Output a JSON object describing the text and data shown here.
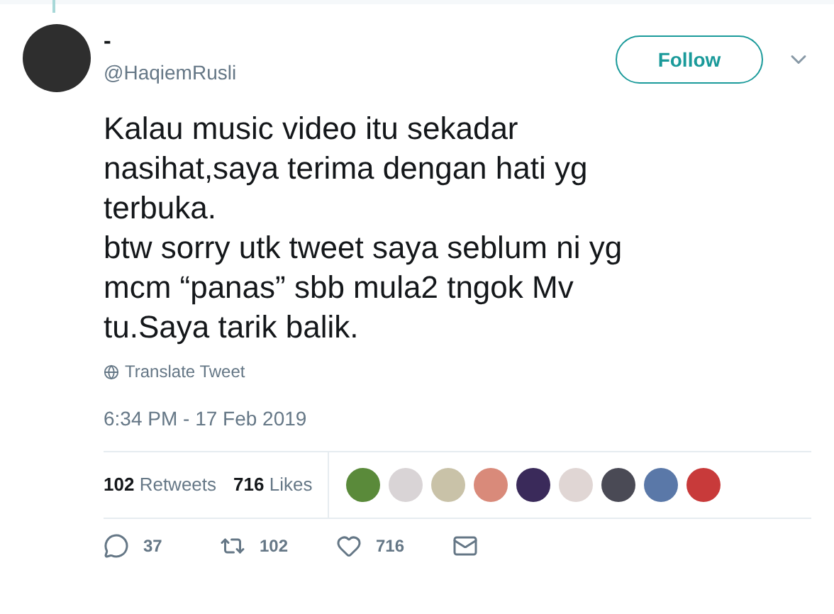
{
  "author": {
    "name": "-",
    "handle": "@HaqiemRusli"
  },
  "follow_button": {
    "label": "Follow"
  },
  "tweet": {
    "lines": [
      "Kalau music video itu sekadar",
      "nasihat,saya terima dengan hati yg",
      "terbuka.",
      "btw sorry utk tweet saya seblum ni yg",
      "mcm “panas” sbb mula2 tngok Mv",
      "tu.Saya tarik balik."
    ]
  },
  "translate_link": "Translate Tweet",
  "timestamp": "6:34 PM - 17 Feb 2019",
  "stats": [
    {
      "count": "102",
      "label": "Retweets"
    },
    {
      "count": "716",
      "label": "Likes"
    }
  ],
  "actions": [
    {
      "kind": "reply",
      "count": "37"
    },
    {
      "kind": "retweet",
      "count": "102"
    },
    {
      "kind": "like",
      "count": "716"
    },
    {
      "kind": "message"
    }
  ]
}
